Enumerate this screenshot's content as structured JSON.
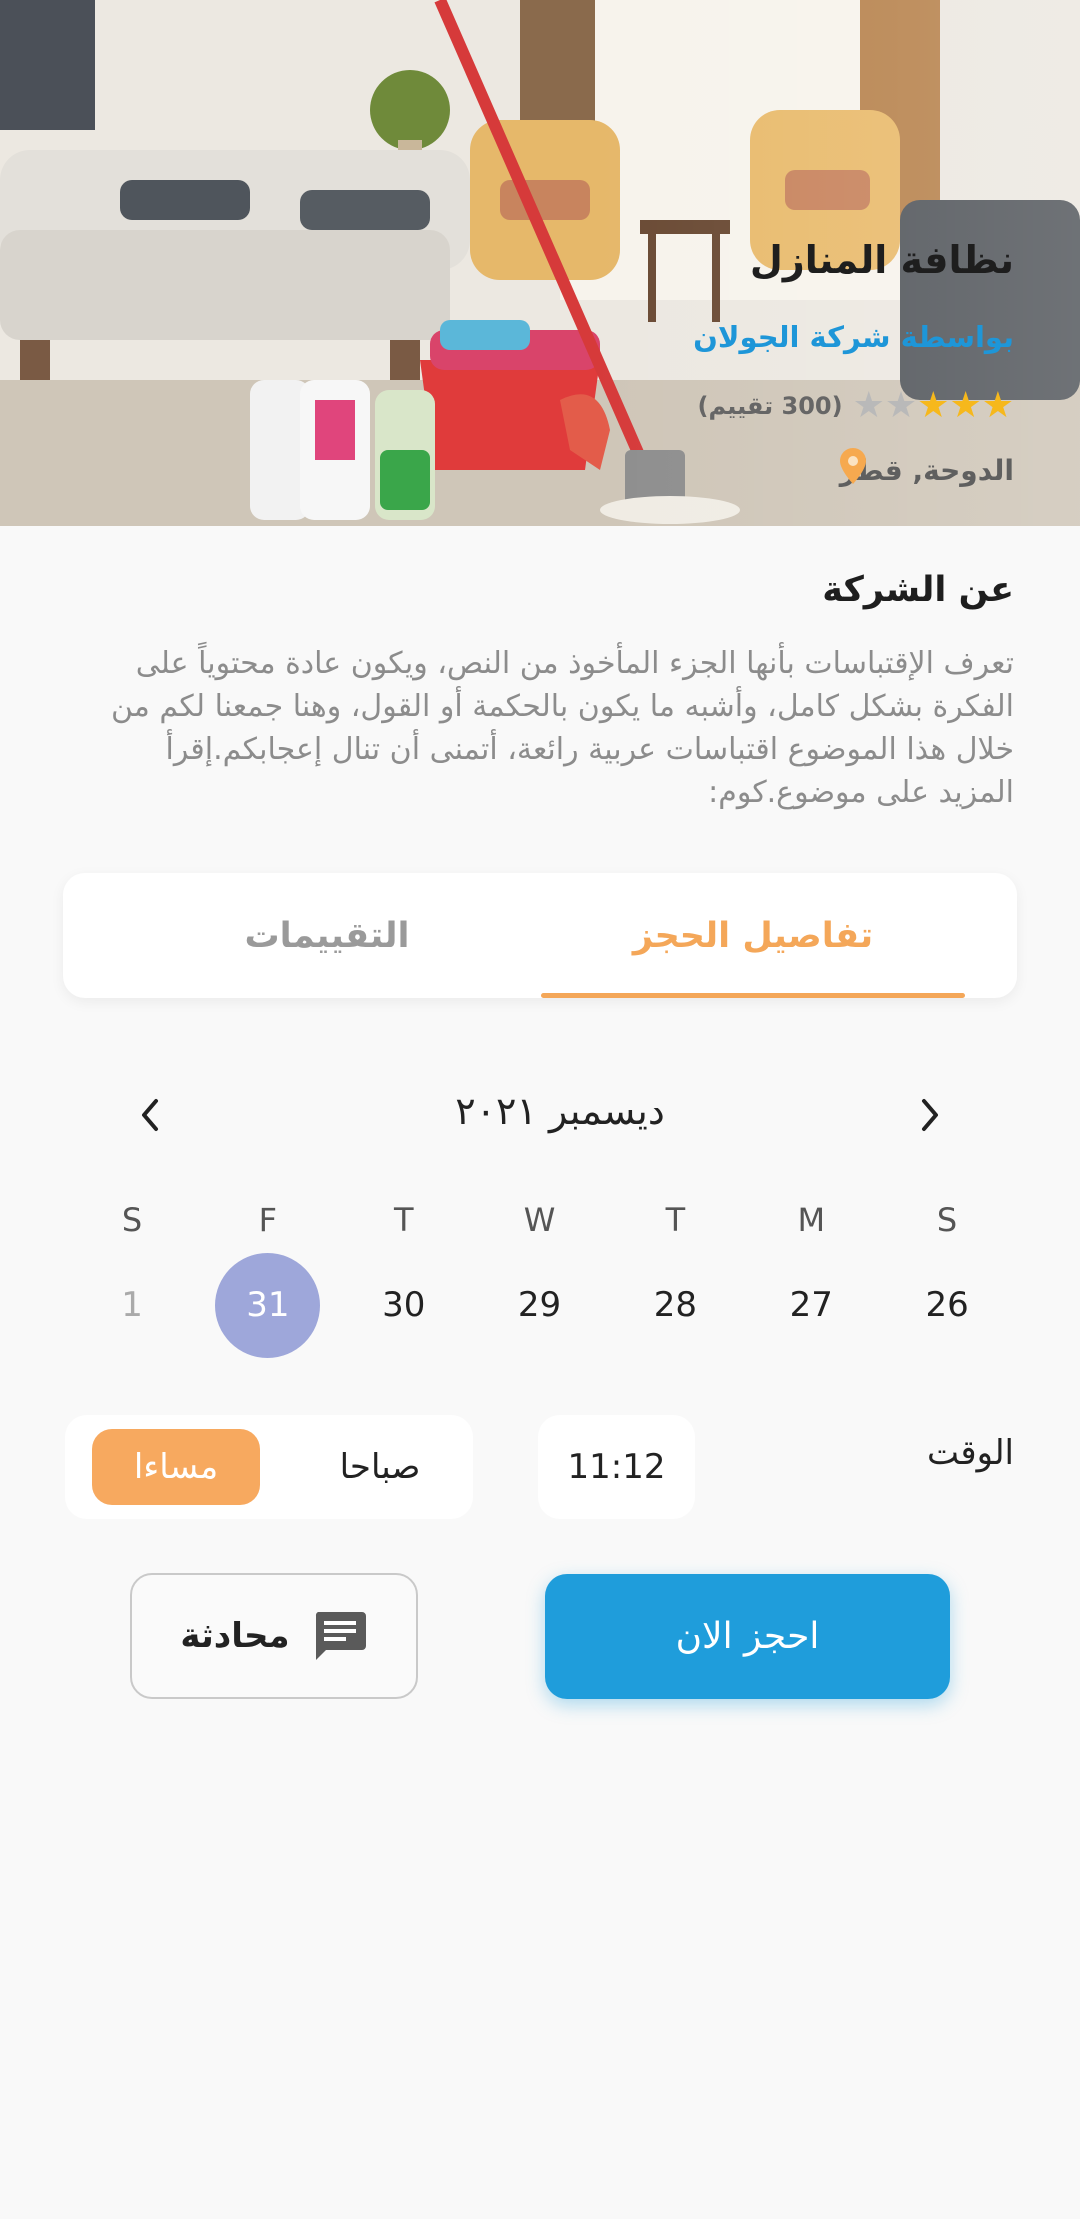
{
  "hero": {
    "title": "نظافة المنازل",
    "provider": "بواسطة شركة الجولان",
    "rating": {
      "stars_filled": 3,
      "stars_total": 5,
      "count_text": "(300 تقييم)"
    },
    "location": "الدوحة, قطر"
  },
  "about": {
    "title": "عن الشركة",
    "body": "تعرف الإقتباسات بأنها الجزء المأخوذ من النص، ويكون عادة محتوياً على الفكرة بشكل كامل، وأشبه ما يكون بالحكمة أو القول، وهنا جمعنا لكم من خلال هذا الموضوع اقتباسات عربية رائعة، أتمنى أن تنال إعجابكم.إقرأ المزيد على موضوع.كوم:"
  },
  "tabs": [
    {
      "label": "تفاصيل الحجز",
      "active": true
    },
    {
      "label": "التقييمات",
      "active": false
    }
  ],
  "calendar": {
    "month": "ديسمبر ٢٠٢١",
    "weekdays": [
      "S",
      "M",
      "T",
      "W",
      "T",
      "F",
      "S"
    ],
    "days": [
      {
        "n": "26",
        "state": "normal"
      },
      {
        "n": "27",
        "state": "normal"
      },
      {
        "n": "28",
        "state": "normal"
      },
      {
        "n": "29",
        "state": "normal"
      },
      {
        "n": "30",
        "state": "normal"
      },
      {
        "n": "31",
        "state": "selected"
      },
      {
        "n": "1",
        "state": "muted"
      }
    ]
  },
  "time": {
    "label": "الوقت",
    "value": "11:12",
    "am": "صباحا",
    "pm": "مساءا",
    "selected": "pm"
  },
  "actions": {
    "book": "احجز الان",
    "chat": "محادثة"
  },
  "colors": {
    "accent_orange": "#f4a759",
    "primary_blue": "#1f9ddb",
    "selected_day": "#9ea7da",
    "star": "#f6b81c"
  }
}
